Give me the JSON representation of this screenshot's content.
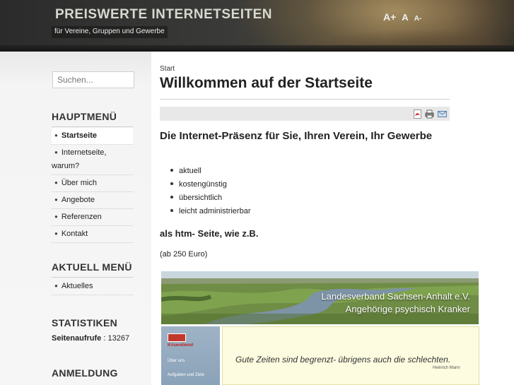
{
  "header": {
    "title": "PREISWERTE INTERNETSEITEN",
    "slogan": "für Vereine, Gruppen und Gewerbe",
    "font_tools": {
      "bigger": "A+",
      "reset": "A",
      "smaller": "A-"
    }
  },
  "sidebar": {
    "search_placeholder": "Suchen...",
    "main_menu": {
      "title": "HAUPTMENÜ",
      "items": [
        {
          "label": "Startseite",
          "active": true
        },
        {
          "label": "Internetseite,",
          "label2": "warum?"
        },
        {
          "label": "Über mich"
        },
        {
          "label": "Angebote"
        },
        {
          "label": "Referenzen"
        },
        {
          "label": "Kontakt"
        }
      ]
    },
    "news_menu": {
      "title": "AKTUELL MENÜ",
      "items": [
        {
          "label": "Aktuelles"
        }
      ]
    },
    "stats": {
      "title": "STATISTIKEN",
      "label": "Seitenaufrufe",
      "value": ": 13267"
    },
    "login": {
      "title": "ANMELDUNG"
    }
  },
  "main": {
    "breadcrumb": "Start",
    "title": "Willkommen auf der Startseite",
    "icons": [
      "pdf-icon",
      "print-icon",
      "email-icon"
    ],
    "heading": "Die Internet-Präsenz für Sie, Ihren Verein, Ihr Gewerbe",
    "bullets": [
      "aktuell",
      "kostengünstig",
      "übersichtlich",
      "leicht administrierbar"
    ],
    "subheading": "als htm- Seite, wie z.B.",
    "price": "(ab 250 Euro)",
    "banner": {
      "line1": "Landesverband Sachsen-Anhalt e.V.",
      "line2": "Angehörige psychisch Kranker"
    },
    "example_nav": {
      "logo_label": "Krisendienst",
      "items": [
        "Über uns",
        "Aufgaben und Ziele"
      ]
    },
    "quote": {
      "text": "Gute Zeiten sind begrenzt- übrigens auch die schlechten.",
      "author": "Heinrich Mann"
    }
  },
  "colors": {
    "header_dark": "#2b2b2b",
    "sidebar_bg": "#f4f4f4",
    "quote_bg": "#fdfce0",
    "nav_blue": "#9fb3c6"
  }
}
